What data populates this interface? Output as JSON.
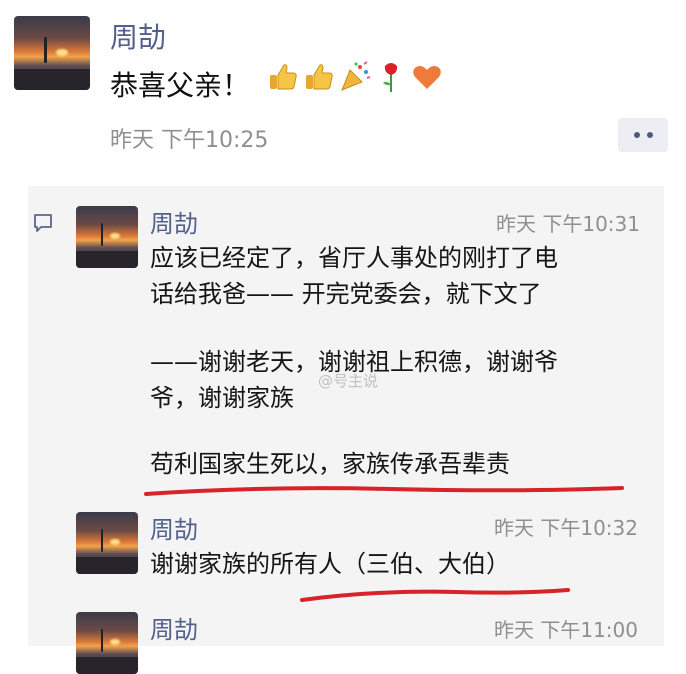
{
  "post": {
    "author": "周劼",
    "text": "恭喜父亲！",
    "emojis": [
      "thumbs-up-icon",
      "thumbs-up-icon",
      "party-popper-icon",
      "rose-icon",
      "heart-icon"
    ],
    "time": "昨天 下午10:25"
  },
  "comments": [
    {
      "author": "周劼",
      "time": "昨天 下午10:31",
      "lines": [
        "应该已经定了，省厅人事处的刚打了电",
        "话给我爸—— 开完党委会，就下文了",
        "",
        "——谢谢老天，谢谢祖上积德，谢谢爷",
        "爷，谢谢家族",
        "",
        "苟利国家生死以，家族传承吾辈责"
      ]
    },
    {
      "author": "周劼",
      "time": "昨天 下午10:32",
      "lines": [
        "谢谢家族的所有人（三伯、大伯）"
      ]
    },
    {
      "author": "周劼",
      "time": "昨天 下午11:00",
      "lines": []
    }
  ],
  "watermark": "@号主说",
  "colors": {
    "name": "#52608a",
    "underline": "#d8232a",
    "time": "#8f8f8f"
  }
}
